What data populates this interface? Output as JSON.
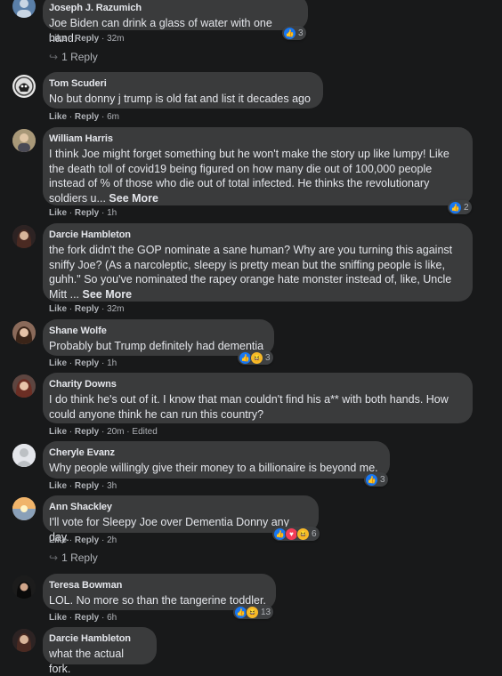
{
  "comments": [
    {
      "author": "Joseph J. Razumich",
      "text": "Joe Biden can drink a glass of water with one hand.",
      "actions": {
        "like": "Like",
        "reply": "Reply",
        "time": "32m"
      },
      "reactions": {
        "icons": [
          "like-icon"
        ],
        "count": "3"
      },
      "replies": "1 Reply"
    },
    {
      "author": "Tom Scuderi",
      "text": "No but donny j trump is old fat and list it decades ago",
      "actions": {
        "like": "Like",
        "reply": "Reply",
        "time": "6m"
      }
    },
    {
      "author": "William Harris",
      "text": "I think Joe might forget something but he won't make the story up like lumpy! Like the death toll of covid19 being figured on how many die out of 100,000 people instead of % of those who die out of total infected. He thinks the revolutionary soldiers u...",
      "see_more": "See More",
      "actions": {
        "like": "Like",
        "reply": "Reply",
        "time": "1h"
      },
      "reactions": {
        "icons": [
          "like-icon"
        ],
        "count": "2"
      }
    },
    {
      "author": "Darcie Hambleton",
      "text": "the fork didn't the GOP nominate a sane human? Why are you turning this against sniffy Joe? (As a narcoleptic, sleepy is pretty mean but the sniffing people is like, guhh.\" So you've nominated the rapey orange hate monster instead of, like, Uncle Mitt ...",
      "see_more": "See More",
      "actions": {
        "like": "Like",
        "reply": "Reply",
        "time": "32m"
      }
    },
    {
      "author": "Shane Wolfe",
      "text": "Probably but Trump definitely had dementia",
      "actions": {
        "like": "Like",
        "reply": "Reply",
        "time": "1h"
      },
      "reactions": {
        "icons": [
          "like-icon",
          "haha-icon"
        ],
        "count": "3"
      }
    },
    {
      "author": "Charity Downs",
      "text": "I do think he's out of it. I know that man couldn't find his a** with both hands. How could anyone think he can run this country?",
      "actions": {
        "like": "Like",
        "reply": "Reply",
        "time": "20m",
        "edited": "Edited"
      }
    },
    {
      "author": "Cheryle Evanz",
      "text": "Why people willingly give their money to a billionaire is beyond me.",
      "actions": {
        "like": "Like",
        "reply": "Reply",
        "time": "3h"
      },
      "reactions": {
        "icons": [
          "like-icon"
        ],
        "count": "3"
      }
    },
    {
      "author": "Ann Shackley",
      "text": "I'll vote for Sleepy Joe over Dementia Donny any day.",
      "actions": {
        "like": "Like",
        "reply": "Reply",
        "time": "2h"
      },
      "reactions": {
        "icons": [
          "like-icon",
          "love-icon",
          "haha-icon"
        ],
        "count": "6"
      },
      "replies": "1 Reply"
    },
    {
      "author": "Teresa Bowman",
      "text": "LOL. No more so than the tangerine toddler.",
      "actions": {
        "like": "Like",
        "reply": "Reply",
        "time": "6h"
      },
      "reactions": {
        "icons": [
          "like-icon",
          "haha-icon"
        ],
        "count": "13"
      }
    },
    {
      "author": "Darcie Hambleton",
      "text": "what the actual fork."
    }
  ],
  "separator": "·",
  "colors": {
    "background": "#18191a",
    "bubble": "#3a3b3c",
    "text": "#e4e6eb",
    "meta": "#b0b3b8",
    "like": "#1877f2",
    "haha": "#f7b928",
    "love": "#f33e58"
  }
}
